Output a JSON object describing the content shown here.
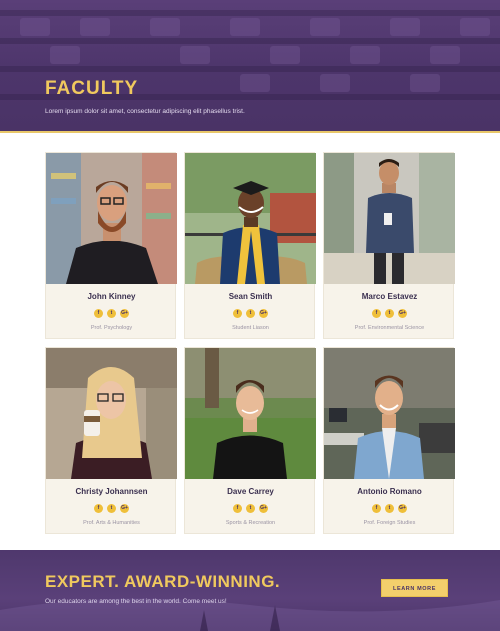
{
  "hero": {
    "title": "FACULTY",
    "subtitle": "Lorem ipsum dolor sit amet, consectetur adipiscing elit phasellus trist."
  },
  "faculty": [
    {
      "name": "John Kinney",
      "role": "Prof. Psychology"
    },
    {
      "name": "Sean Smith",
      "role": "Student Liason"
    },
    {
      "name": "Marco Estavez",
      "role": "Prof. Environmental Science"
    },
    {
      "name": "Christy Johannsen",
      "role": "Prof. Arts & Humanities"
    },
    {
      "name": "Dave Carrey",
      "role": "Sports & Recreation"
    },
    {
      "name": "Antonio Romano",
      "role": "Prof. Foreign Studies"
    }
  ],
  "social_icons": {
    "facebook": "f",
    "twitter": "t",
    "google": "G+"
  },
  "band": {
    "title": "EXPERT. AWARD-WINNING.",
    "subtitle": "Our educators are among the best in the world. Come meet us!",
    "button_label": "LEARN MORE"
  },
  "colors": {
    "primary": "#4a3366",
    "accent": "#f0c95e",
    "card_bg": "#f7f3ea"
  }
}
